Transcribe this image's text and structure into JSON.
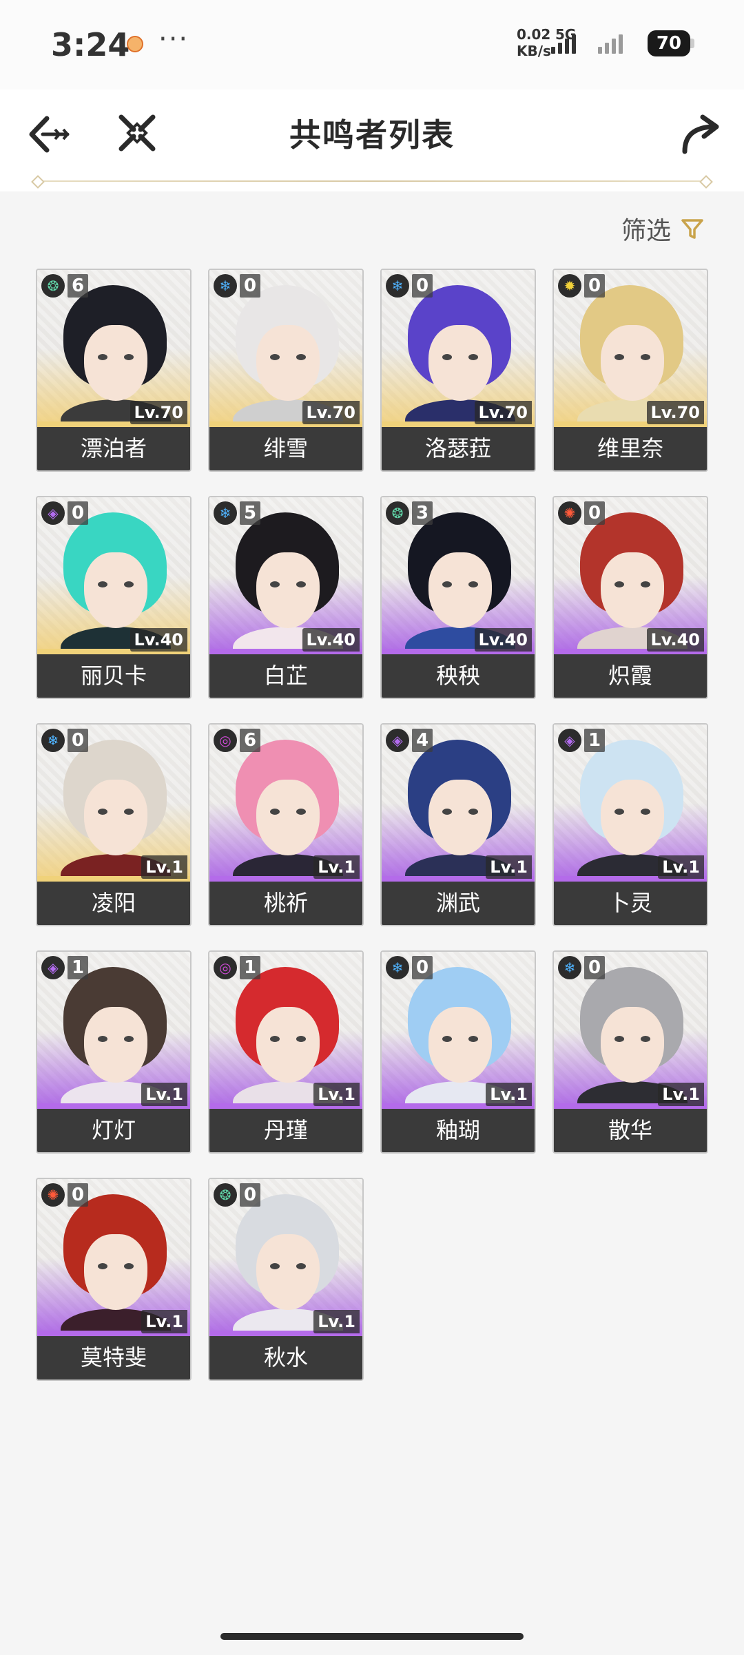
{
  "status_bar": {
    "time": "3:24",
    "net_speed_value": "0.02",
    "net_speed_unit": "KB/s",
    "network": "5G",
    "battery": "70"
  },
  "header": {
    "title": "共鸣者列表"
  },
  "filter": {
    "label": "筛选"
  },
  "colors": {
    "gold_rarity": "#f0d27a",
    "purple_rarity": "#b46bea",
    "name_bar": "#3a3a3a",
    "accent": "#c9a34b"
  },
  "characters": [
    {
      "name": "漂泊者",
      "level": "Lv.70",
      "chain": "6",
      "element_icon": "aero-icon",
      "element_color": "#5fd3a6",
      "rarity": "gold",
      "hair": "#1e1f27",
      "outfit": "#3b3b3b"
    },
    {
      "name": "绯雪",
      "level": "Lv.70",
      "chain": "0",
      "element_icon": "glacio-icon",
      "element_color": "#4fb3ff",
      "rarity": "gold",
      "hair": "#e8e6e6",
      "outfit": "#cfcfcf"
    },
    {
      "name": "洛瑟菈",
      "level": "Lv.70",
      "chain": "0",
      "element_icon": "glacio-icon",
      "element_color": "#4fb3ff",
      "rarity": "gold",
      "hair": "#5a43c9",
      "outfit": "#2a2f6a"
    },
    {
      "name": "维里奈",
      "level": "Lv.70",
      "chain": "0",
      "element_icon": "spectro-icon",
      "element_color": "#f2d23a",
      "rarity": "gold",
      "hair": "#e2c985",
      "outfit": "#e9dcb0"
    },
    {
      "name": "丽贝卡",
      "level": "Lv.40",
      "chain": "0",
      "element_icon": "havoc-icon",
      "element_color": "#b36cf0",
      "rarity": "gold",
      "hair": "#39d6c2",
      "outfit": "#1e3136"
    },
    {
      "name": "白芷",
      "level": "Lv.40",
      "chain": "5",
      "element_icon": "glacio-icon",
      "element_color": "#4fb3ff",
      "rarity": "purple",
      "hair": "#1d1b1f",
      "outfit": "#f2e6ec"
    },
    {
      "name": "秧秧",
      "level": "Lv.40",
      "chain": "3",
      "element_icon": "aero-icon",
      "element_color": "#5fd3a6",
      "rarity": "purple",
      "hair": "#151722",
      "outfit": "#2e4ca0"
    },
    {
      "name": "炽霞",
      "level": "Lv.40",
      "chain": "0",
      "element_icon": "fusion-icon",
      "element_color": "#ff5a3a",
      "rarity": "purple",
      "hair": "#b3342b",
      "outfit": "#e0d3cf"
    },
    {
      "name": "凌阳",
      "level": "Lv.1",
      "chain": "0",
      "element_icon": "glacio-icon",
      "element_color": "#4fb3ff",
      "rarity": "gold",
      "hair": "#ddd6cc",
      "outfit": "#7a2222"
    },
    {
      "name": "桃祈",
      "level": "Lv.1",
      "chain": "6",
      "element_icon": "electro-icon",
      "element_color": "#d14bd8",
      "rarity": "purple",
      "hair": "#ef8fb2",
      "outfit": "#2a2636"
    },
    {
      "name": "渊武",
      "level": "Lv.1",
      "chain": "4",
      "element_icon": "havoc-icon",
      "element_color": "#b36cf0",
      "rarity": "purple",
      "hair": "#2b3f84",
      "outfit": "#2b3057"
    },
    {
      "name": "卜灵",
      "level": "Lv.1",
      "chain": "1",
      "element_icon": "havoc-icon",
      "element_color": "#b36cf0",
      "rarity": "purple",
      "hair": "#cde3f2",
      "outfit": "#2b2b34"
    },
    {
      "name": "灯灯",
      "level": "Lv.1",
      "chain": "1",
      "element_icon": "havoc-icon",
      "element_color": "#b36cf0",
      "rarity": "purple",
      "hair": "#4a3b34",
      "outfit": "#ece4ee"
    },
    {
      "name": "丹瑾",
      "level": "Lv.1",
      "chain": "1",
      "element_icon": "electro-icon",
      "element_color": "#d14bd8",
      "rarity": "purple",
      "hair": "#d52a2e",
      "outfit": "#e9e0e8"
    },
    {
      "name": "釉瑚",
      "level": "Lv.1",
      "chain": "0",
      "element_icon": "glacio-icon",
      "element_color": "#4fb3ff",
      "rarity": "purple",
      "hair": "#9fcdf3",
      "outfit": "#e6e8f2"
    },
    {
      "name": "散华",
      "level": "Lv.1",
      "chain": "0",
      "element_icon": "glacio-icon",
      "element_color": "#4fb3ff",
      "rarity": "purple",
      "hair": "#a9a9ad",
      "outfit": "#2d2d33"
    },
    {
      "name": "莫特斐",
      "level": "Lv.1",
      "chain": "0",
      "element_icon": "fusion-icon",
      "element_color": "#ff5a3a",
      "rarity": "purple",
      "hair": "#b72b1e",
      "outfit": "#3b1f2b"
    },
    {
      "name": "秋水",
      "level": "Lv.1",
      "chain": "0",
      "element_icon": "aero-icon",
      "element_color": "#5fd3a6",
      "rarity": "purple",
      "hair": "#d8dbe0",
      "outfit": "#ebe8ef"
    }
  ]
}
